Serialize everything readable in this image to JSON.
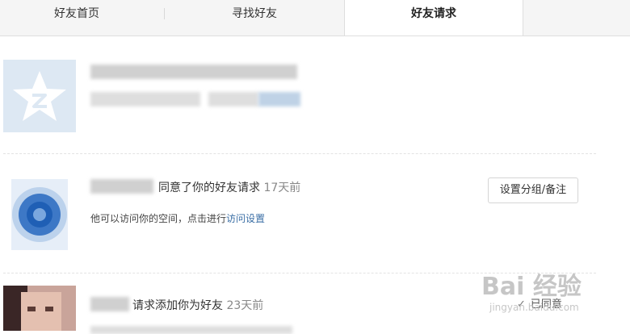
{
  "tabs": [
    {
      "label": "好友首页"
    },
    {
      "label": "寻找好友"
    },
    {
      "label": "好友请求"
    }
  ],
  "requests": [
    {
      "name": "",
      "message": "",
      "avatar": "qzone-star-icon"
    },
    {
      "action": "同意了你的好友请求",
      "time": "17天前",
      "note": "他可以访问你的空间，点击进行",
      "link": "访问设置",
      "button": "设置分组/备注"
    },
    {
      "action": "请求添加你为好友",
      "time": "23天前",
      "status": "已同意"
    }
  ],
  "watermark": {
    "main": "Bai 经验",
    "sub": "jingyan.baidu.com"
  },
  "colors": {
    "link": "#3a6ea5",
    "tab_bar": "#f5f5f5",
    "avatar_blue": "#1f5fb5"
  }
}
